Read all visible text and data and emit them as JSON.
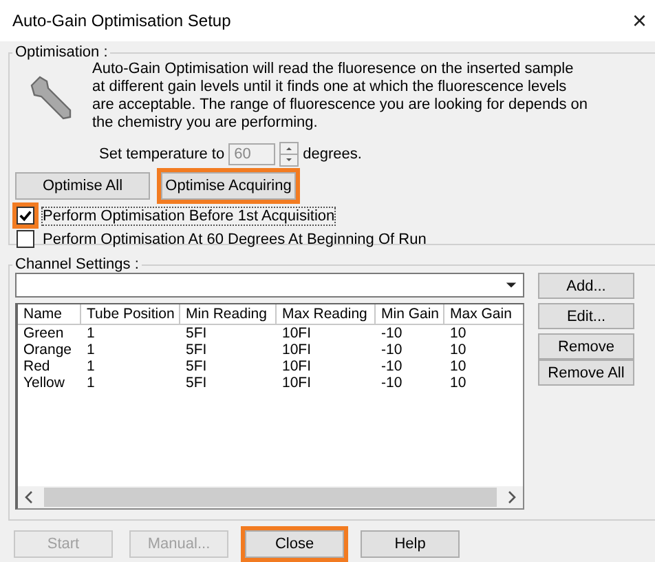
{
  "window": {
    "title": "Auto-Gain Optimisation Setup",
    "close": "×"
  },
  "optimisation": {
    "legend": "Optimisation :",
    "description": "Auto-Gain Optimisation will read the fluoresence on the inserted sample at different gain levels until it finds one at which the fluorescence levels are acceptable. The range of fluorescence you are looking for depends on the chemistry you are performing.",
    "temperature": {
      "label": "Set temperature to",
      "value": "60",
      "unit": "degrees."
    },
    "buttons": [
      {
        "label": "Optimise All",
        "highlighted": false
      },
      {
        "label": "Optimise Acquiring",
        "highlighted": true
      }
    ],
    "options": [
      {
        "label": "Perform Optimisation Before 1st Acquisition",
        "checked": true,
        "highlighted": true
      },
      {
        "label": "Perform Optimisation At 60 Degrees At Beginning Of Run",
        "checked": false,
        "highlighted": false
      }
    ]
  },
  "channel_settings": {
    "legend": "Channel Settings :",
    "columns": [
      "Name",
      "Tube Position",
      "Min Reading",
      "Max Reading",
      "Min Gain",
      "Max Gain"
    ],
    "rows": [
      [
        "Green",
        "1",
        "5FI",
        "10FI",
        "-10",
        "10"
      ],
      [
        "Orange",
        "1",
        "5FI",
        "10FI",
        "-10",
        "10"
      ],
      [
        "Red",
        "1",
        "5FI",
        "10FI",
        "-10",
        "10"
      ],
      [
        "Yellow",
        "1",
        "5FI",
        "10FI",
        "-10",
        "10"
      ]
    ],
    "side_buttons": [
      "Add...",
      "Edit...",
      "Remove",
      "Remove All"
    ]
  },
  "footer_buttons": [
    {
      "label": "Start",
      "disabled": true,
      "highlighted": false
    },
    {
      "label": "Manual...",
      "disabled": true,
      "highlighted": false
    },
    {
      "label": "Close",
      "disabled": false,
      "highlighted": true
    },
    {
      "label": "Help",
      "disabled": false,
      "highlighted": false
    }
  ]
}
